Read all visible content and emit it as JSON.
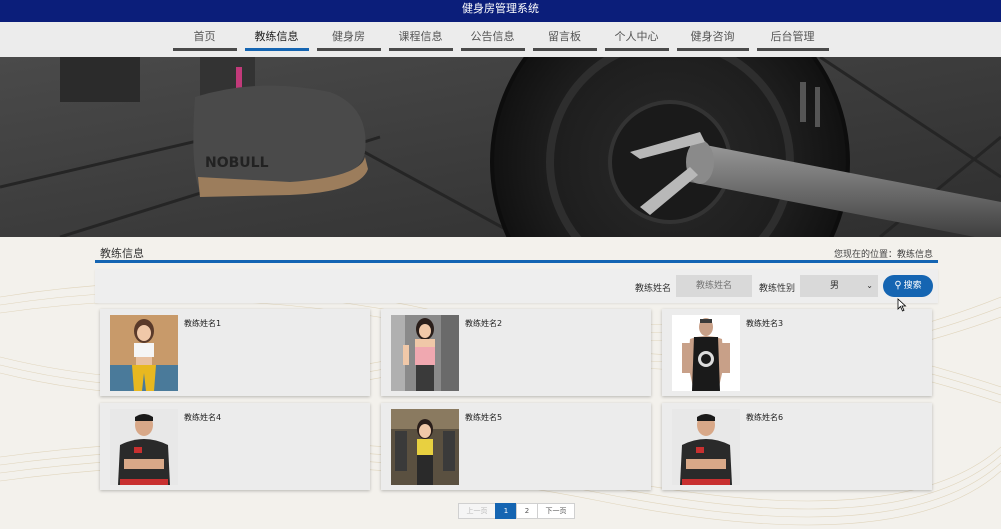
{
  "app": {
    "title": "健身房管理系统"
  },
  "nav": {
    "items": [
      {
        "label": "首页",
        "active": false
      },
      {
        "label": "教练信息",
        "active": true
      },
      {
        "label": "健身房",
        "active": false
      },
      {
        "label": "课程信息",
        "active": false
      },
      {
        "label": "公告信息",
        "active": false
      },
      {
        "label": "留言板",
        "active": false
      },
      {
        "label": "个人中心",
        "active": false
      },
      {
        "label": "健身咨询",
        "active": false
      },
      {
        "label": "后台管理",
        "active": false
      }
    ]
  },
  "section": {
    "title": "教练信息",
    "breadcrumb": "您现在的位置：教练信息"
  },
  "search": {
    "name_label": "教练姓名",
    "name_placeholder": "教练姓名",
    "gender_label": "教练性别",
    "gender_value": "男",
    "button_label": "搜索",
    "button_icon": "search-icon"
  },
  "cards": [
    {
      "name": "教练姓名1"
    },
    {
      "name": "教练姓名2"
    },
    {
      "name": "教练姓名3"
    },
    {
      "name": "教练姓名4"
    },
    {
      "name": "教练姓名5"
    },
    {
      "name": "教练姓名6"
    }
  ],
  "pagination": {
    "prev": "上一页",
    "pages": [
      "1",
      "2"
    ],
    "current": "1",
    "next": "下一页"
  },
  "colors": {
    "title_bar": "#0b1e7a",
    "accent": "#1565b2"
  }
}
